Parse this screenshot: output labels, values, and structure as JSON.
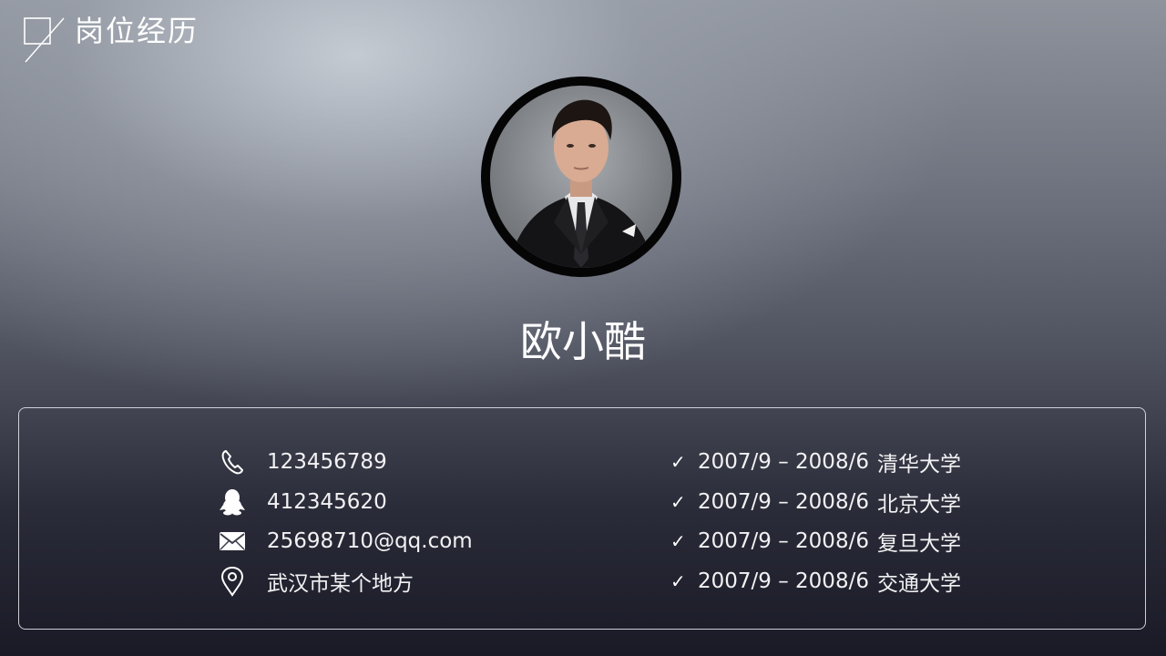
{
  "header": {
    "title": "岗位经历",
    "logo_icon": "square-slash-logo-icon"
  },
  "profile": {
    "name": "欧小酷",
    "avatar_icon": "portrait-photo"
  },
  "contacts": [
    {
      "icon": "phone-icon",
      "text": "123456789"
    },
    {
      "icon": "qq-penguin-icon",
      "text": "412345620"
    },
    {
      "icon": "mail-icon",
      "text": "25698710@qq.com"
    },
    {
      "icon": "location-pin-icon",
      "text": "武汉市某个地方"
    }
  ],
  "education": [
    {
      "dates": "2007/9 – 2008/6",
      "school": "清华大学"
    },
    {
      "dates": "2007/9 – 2008/6",
      "school": "北京大学"
    },
    {
      "dates": "2007/9 – 2008/6",
      "school": "复旦大学"
    },
    {
      "dates": "2007/9 – 2008/6",
      "school": "交通大学"
    }
  ],
  "check_glyph": "✓",
  "colors": {
    "text": "#ffffff",
    "card_border": "#e1e1e8",
    "background_top": "#b4b9c0",
    "background_bottom": "#1a1a27"
  }
}
